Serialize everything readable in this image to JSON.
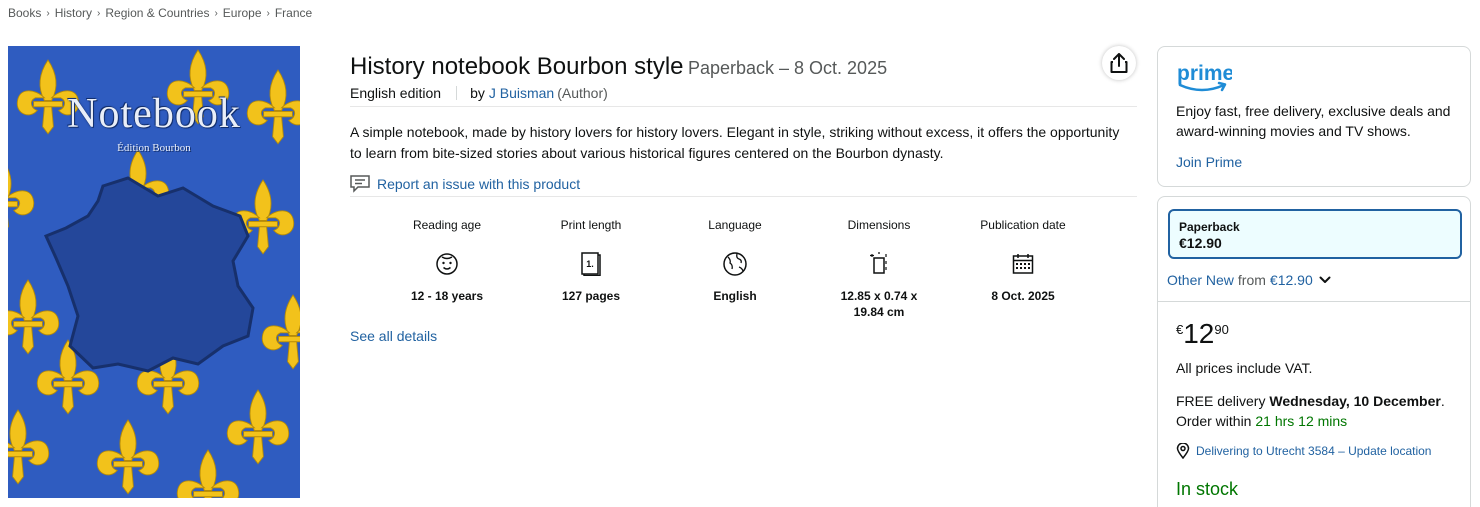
{
  "breadcrumb": [
    "Books",
    "History",
    "Region & Countries",
    "Europe",
    "France"
  ],
  "cover": {
    "title": "Notebook",
    "subtitle": "Édition Bourbon",
    "colors": {
      "background": "#2f5cc0",
      "fleur": "#f2c21b",
      "map": "#24479a"
    }
  },
  "product": {
    "title": "History notebook Bourbon style",
    "format_date": "Paperback – 8 Oct. 2025",
    "edition": "English edition",
    "by": "by",
    "author": "J Buisman",
    "author_role": "(Author)",
    "description": "A simple notebook, made by history lovers for history lovers. Elegant in style, striking without excess, it offers the opportunity to learn from bite-sized stories about various historical figures centered on the Bourbon dynasty.",
    "report_issue": "Report an issue with this product",
    "see_all": "See all details"
  },
  "details": [
    {
      "label": "Reading age",
      "value": "12 - 18 years",
      "icon": "child-face-icon"
    },
    {
      "label": "Print length",
      "value": "127 pages",
      "icon": "book-pages-icon"
    },
    {
      "label": "Language",
      "value": "English",
      "icon": "globe-icon"
    },
    {
      "label": "Dimensions",
      "value": "12.85 x 0.74 x 19.84 cm",
      "icon": "dimensions-icon"
    },
    {
      "label": "Publication date",
      "value": "8 Oct. 2025",
      "icon": "calendar-icon"
    }
  ],
  "prime": {
    "logo": "prime",
    "text": "Enjoy fast, free delivery, exclusive deals and award-winning movies and TV shows.",
    "join": "Join Prime"
  },
  "buy": {
    "format_label": "Paperback",
    "format_price": "€12.90",
    "other_new_1": "Other New",
    "other_new_2": "from",
    "other_new_3": "€12.90",
    "price_currency": "€",
    "price_whole": "12",
    "price_fraction": "90",
    "vat": "All prices include VAT.",
    "free_delivery": "FREE delivery",
    "delivery_date": "Wednesday, 10 December",
    "order_within": "Order within",
    "time_left": "21 hrs 12 mins",
    "location": "Delivering to Utrecht 3584 – Update location",
    "stock": "In stock"
  },
  "colors": {
    "link": "#2162a1",
    "success": "#007600",
    "text": "#0F1111",
    "muted": "#565959"
  }
}
